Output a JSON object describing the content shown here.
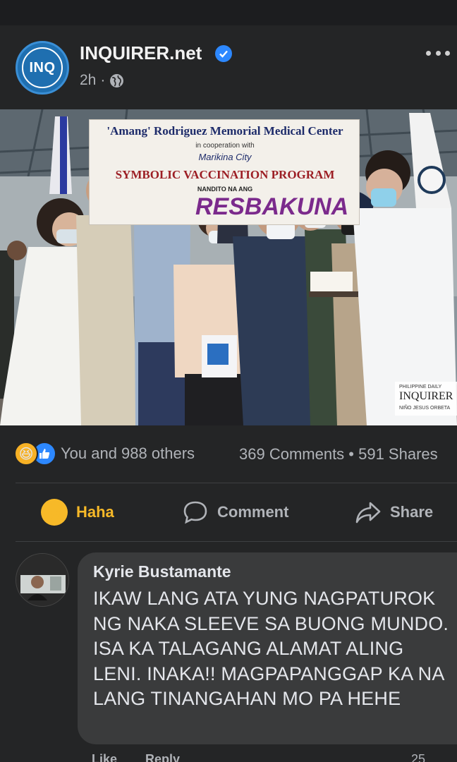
{
  "post": {
    "page_name": "INQUIRER.net",
    "avatar_text": "INQ",
    "time": "2h",
    "photo": {
      "banner_line1": "'Amang' Rodriguez Memorial Medical Center",
      "banner_line2": "in cooperation with",
      "banner_line3": "Marikina City",
      "banner_line4": "SYMBOLIC VACCINATION PROGRAM",
      "banner_line5": "NANDITO NA ANG",
      "banner_line6": "RESBAKUNA",
      "watermark_top": "PHILIPPINE DAILY",
      "watermark_brand": "INQUIRER",
      "watermark_credit": "NIÑO JESUS ORBETA"
    },
    "reactions_text": "You and 988 others",
    "counts_text": "369 Comments • 591 Shares"
  },
  "actions": {
    "haha_label": "Haha",
    "comment_label": "Comment",
    "share_label": "Share"
  },
  "comment": {
    "author": "Kyrie Bustamante",
    "text": "IKAW LANG ATA YUNG NAGPATUROK NG NAKA SLEEVE SA BUONG MUNDO. ISA KA TALAGANG ALAMAT ALING LENI. INAKA!! MAGPAPANGGAP KA NA LANG TINANGAHAN MO PA HEHE",
    "like_label": "Like",
    "reply_label": "Reply",
    "reaction_count": "25"
  },
  "colors": {
    "background": "#242526",
    "accent_blue": "#2d88ff",
    "haha_yellow": "#f7b928"
  }
}
